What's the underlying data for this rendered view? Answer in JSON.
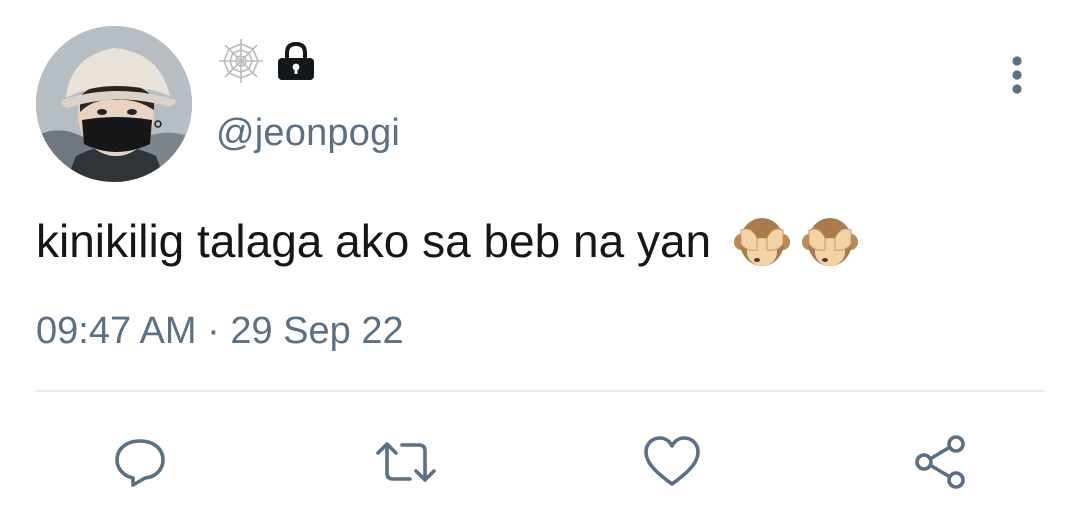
{
  "user": {
    "handle": "@jeonpogi",
    "name_icon": "spiderweb-icon",
    "protected_icon": "lock-icon",
    "avatar": "avatar"
  },
  "tweet": {
    "text": "kinikilig talaga ako sa beb na yan",
    "emojis": [
      "see-no-evil-monkey-icon",
      "see-no-evil-monkey-icon"
    ],
    "time": "09:47 AM",
    "separator": "·",
    "date": "29 Sep 22"
  },
  "actions": [
    {
      "name": "reply",
      "icon": "reply-icon"
    },
    {
      "name": "retweet",
      "icon": "retweet-icon"
    },
    {
      "name": "like",
      "icon": "heart-icon"
    },
    {
      "name": "share",
      "icon": "share-icon"
    }
  ],
  "colors": {
    "text": "#14171a",
    "secondary": "#5b7083",
    "divider": "#e6ecf0"
  }
}
